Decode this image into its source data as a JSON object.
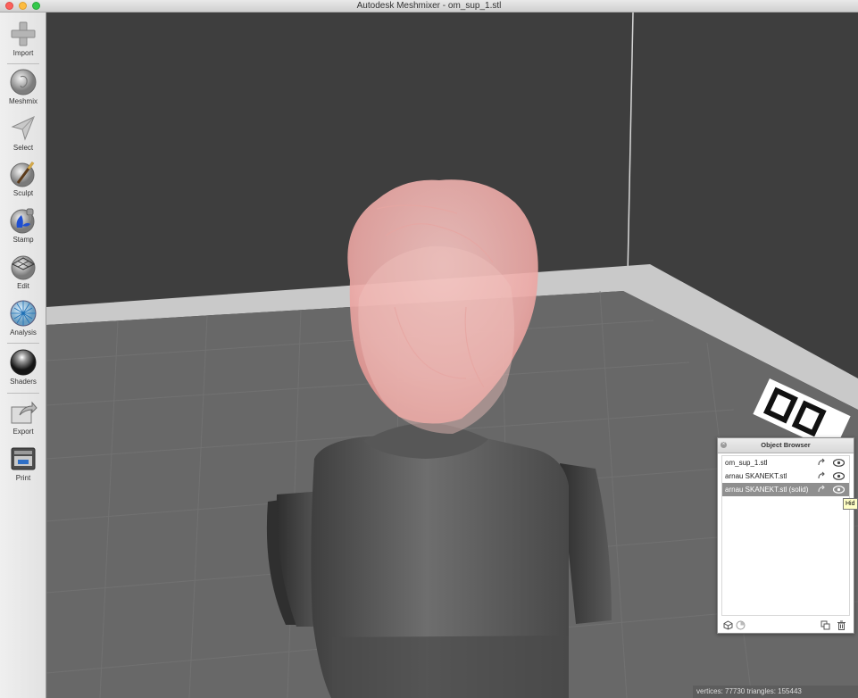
{
  "window": {
    "title": "Autodesk Meshmixer - om_sup_1.stl"
  },
  "toolbar": {
    "items": [
      {
        "label": "Import",
        "icon": "plus-icon"
      },
      {
        "label": "Meshmix",
        "icon": "meshmix-icon"
      },
      {
        "label": "Select",
        "icon": "select-arrow-icon"
      },
      {
        "label": "Sculpt",
        "icon": "sculpt-brush-icon"
      },
      {
        "label": "Stamp",
        "icon": "stamp-icon"
      },
      {
        "label": "Edit",
        "icon": "edit-icon"
      },
      {
        "label": "Analysis",
        "icon": "analysis-icon"
      },
      {
        "label": "Shaders",
        "icon": "shaders-sphere-icon"
      },
      {
        "label": "Export",
        "icon": "export-icon"
      },
      {
        "label": "Print",
        "icon": "printer-icon"
      }
    ]
  },
  "object_browser": {
    "title": "Object Browser",
    "items": [
      {
        "name": "om_sup_1.stl",
        "selected": false
      },
      {
        "name": "arnau SKANEKT.stl",
        "selected": false
      },
      {
        "name": "arnau SKANEKT.stl (solid)",
        "selected": true
      }
    ]
  },
  "tooltip": {
    "text": "Hid"
  },
  "status": {
    "text": "vertices: 77730  triangles: 155443"
  },
  "colors": {
    "background": "#3d3d3d",
    "floor": "#686868",
    "model_body": "#5e5e5e",
    "head": "#f2b3b0",
    "selection": "#8f8f8f"
  }
}
